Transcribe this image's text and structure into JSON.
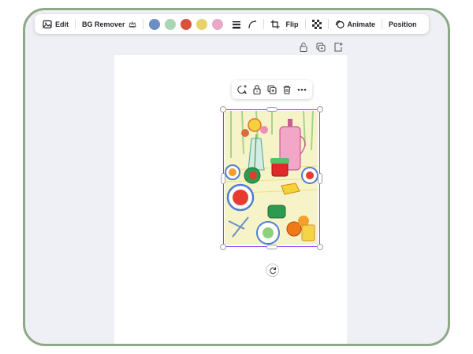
{
  "toolbar": {
    "edit_label": "Edit",
    "bg_remover_label": "BG Remover",
    "flip_label": "Flip",
    "animate_label": "Animate",
    "position_label": "Position",
    "swatches": [
      "#6b8fc4",
      "#a9d6b4",
      "#d9533a",
      "#e8d36a",
      "#e8a8c6"
    ]
  },
  "colors": {
    "accent": "#8b3dff",
    "frame_border": "#8fa888",
    "workspace": "#eef0f5"
  }
}
